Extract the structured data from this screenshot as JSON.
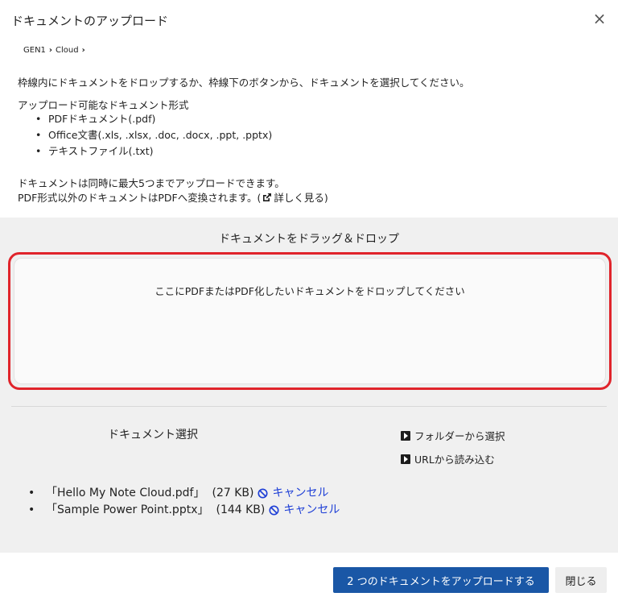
{
  "dialog": {
    "title": "ドキュメントのアップロード",
    "close_icon": "×"
  },
  "breadcrumb": {
    "items": [
      "GEN1",
      "Cloud"
    ],
    "separator": "›"
  },
  "instructions": {
    "main": "枠線内にドキュメントをドロップするか、枠線下のボタンから、ドキュメントを選択してください。",
    "formats_heading": "アップロード可能なドキュメント形式",
    "formats": [
      "PDFドキュメント(.pdf)",
      "Office文書(.xls, .xlsx, .doc, .docx, .ppt, .pptx)",
      "テキストファイル(.txt)"
    ],
    "note_limit": "ドキュメントは同時に最大5つまでアップロードできます。",
    "note_convert": "PDF形式以外のドキュメントはPDFへ変換されます。(",
    "learn_more": "詳しく見る)"
  },
  "drop_zone": {
    "heading": "ドキュメントをドラッグ＆ドロップ",
    "placeholder": "ここにPDFまたはPDF化したいドキュメントをドロップしてください"
  },
  "document_select": {
    "label": "ドキュメント選択",
    "folder_link": "フォルダーから選択",
    "url_link": "URLから読み込む"
  },
  "files": [
    {
      "name": "「Hello My Note Cloud.pdf」",
      "size": "(27 KB)",
      "cancel": "キャンセル"
    },
    {
      "name": "「Sample Power Point.pptx」",
      "size": "(144 KB)",
      "cancel": "キャンセル"
    }
  ],
  "footer": {
    "upload_button": "2 つのドキュメントをアップロードする",
    "close_button": "閉じる"
  },
  "colors": {
    "drop_zone_border": "#e0242b",
    "primary_button": "#1a57a6",
    "cancel_link": "#1e3fd6"
  }
}
